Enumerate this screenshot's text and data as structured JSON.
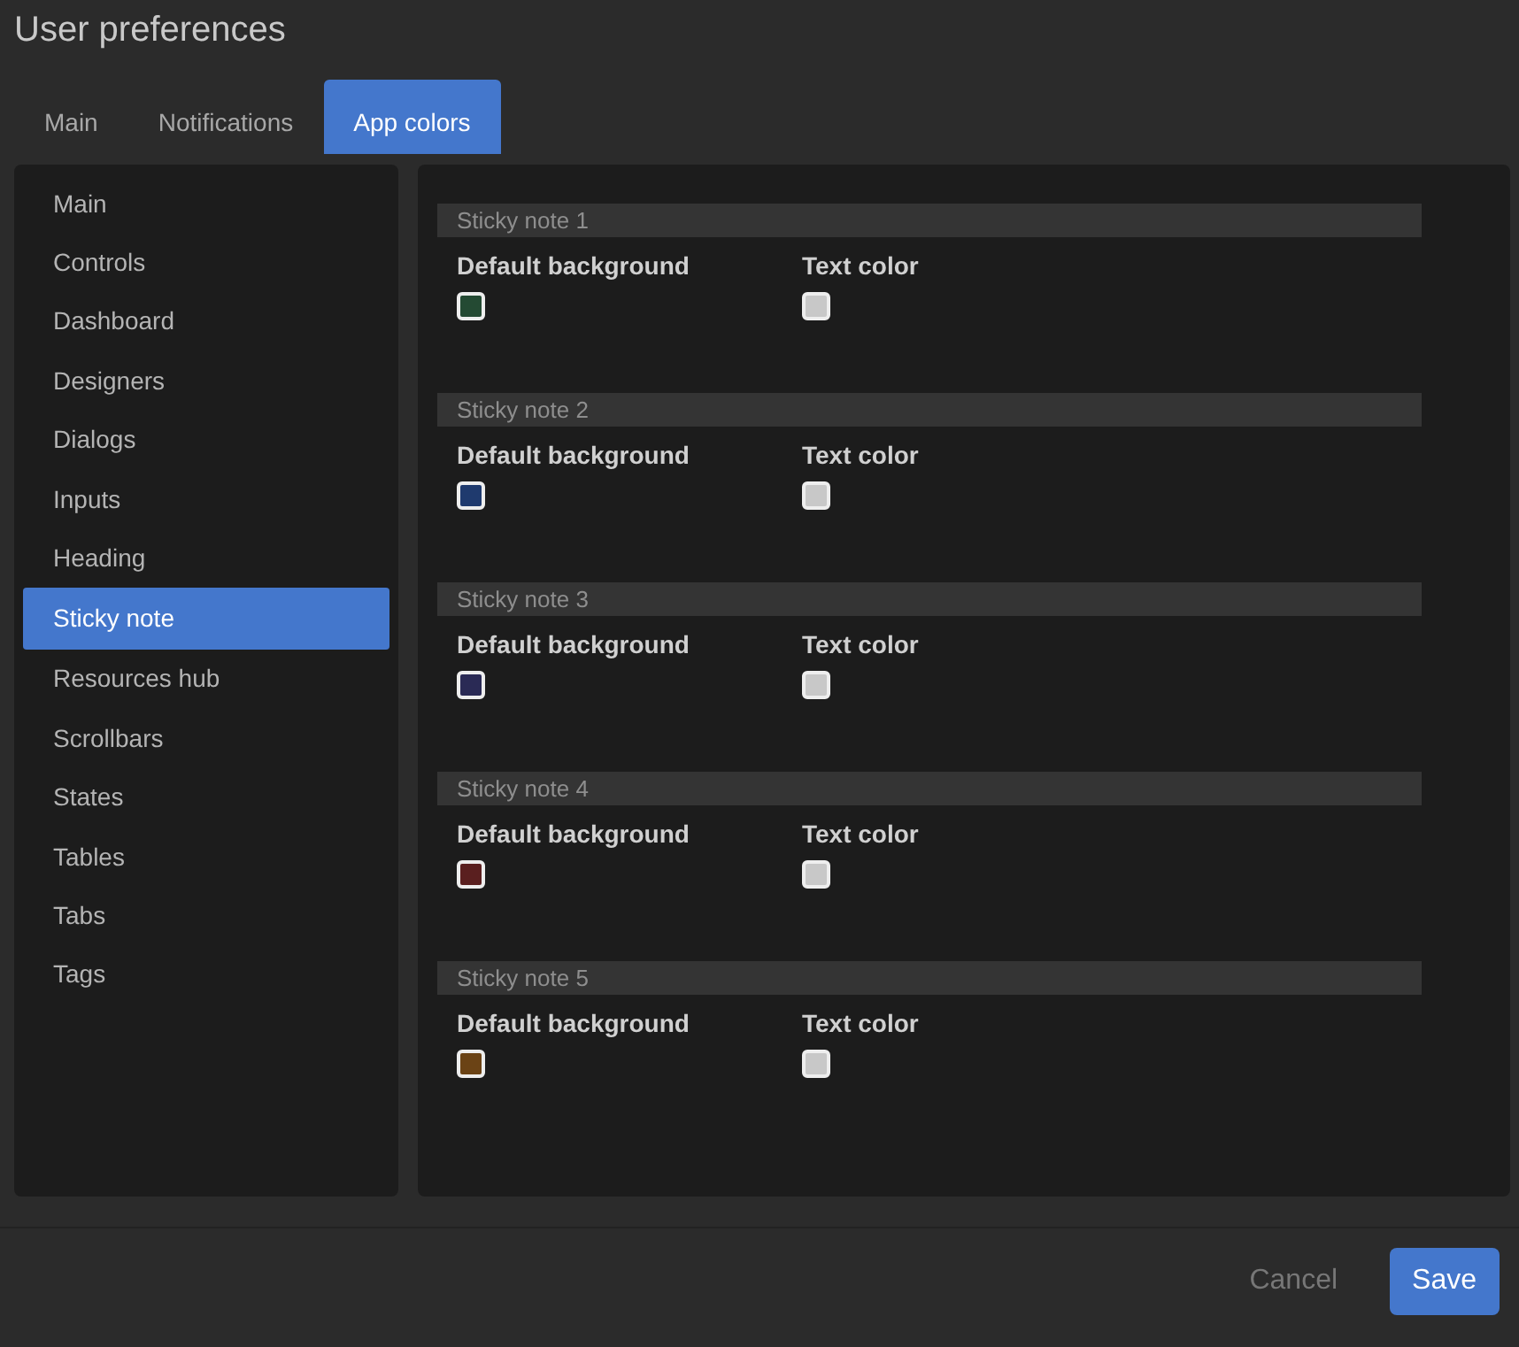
{
  "window": {
    "title": "User preferences"
  },
  "tabs": [
    {
      "label": "Main",
      "selected": false
    },
    {
      "label": "Notifications",
      "selected": false
    },
    {
      "label": "App colors",
      "selected": true
    }
  ],
  "sidebar": {
    "items": [
      {
        "label": "Main",
        "selected": false
      },
      {
        "label": "Controls",
        "selected": false
      },
      {
        "label": "Dashboard",
        "selected": false
      },
      {
        "label": "Designers",
        "selected": false
      },
      {
        "label": "Dialogs",
        "selected": false
      },
      {
        "label": "Inputs",
        "selected": false
      },
      {
        "label": "Heading",
        "selected": false
      },
      {
        "label": "Sticky note",
        "selected": true
      },
      {
        "label": "Resources hub",
        "selected": false
      },
      {
        "label": "Scrollbars",
        "selected": false
      },
      {
        "label": "States",
        "selected": false
      },
      {
        "label": "Tables",
        "selected": false
      },
      {
        "label": "Tabs",
        "selected": false
      },
      {
        "label": "Tags",
        "selected": false
      }
    ]
  },
  "sections": [
    {
      "title": "Sticky note 1",
      "settings": [
        {
          "label": "Default background",
          "color": "#244a33"
        },
        {
          "label": "Text color",
          "color": "#c8c8c8"
        }
      ]
    },
    {
      "title": "Sticky note 2",
      "settings": [
        {
          "label": "Default background",
          "color": "#1f3a6e"
        },
        {
          "label": "Text color",
          "color": "#c8c8c8"
        }
      ]
    },
    {
      "title": "Sticky note 3",
      "settings": [
        {
          "label": "Default background",
          "color": "#2a2a55"
        },
        {
          "label": "Text color",
          "color": "#c8c8c8"
        }
      ]
    },
    {
      "title": "Sticky note 4",
      "settings": [
        {
          "label": "Default background",
          "color": "#5a1f1f"
        },
        {
          "label": "Text color",
          "color": "#c8c8c8"
        }
      ]
    },
    {
      "title": "Sticky note 5",
      "settings": [
        {
          "label": "Default background",
          "color": "#6b4315"
        },
        {
          "label": "Text color",
          "color": "#c8c8c8"
        }
      ]
    }
  ],
  "buttons": [
    {
      "label": "Cancel",
      "kind": "secondary"
    },
    {
      "label": "Save",
      "kind": "primary"
    }
  ]
}
